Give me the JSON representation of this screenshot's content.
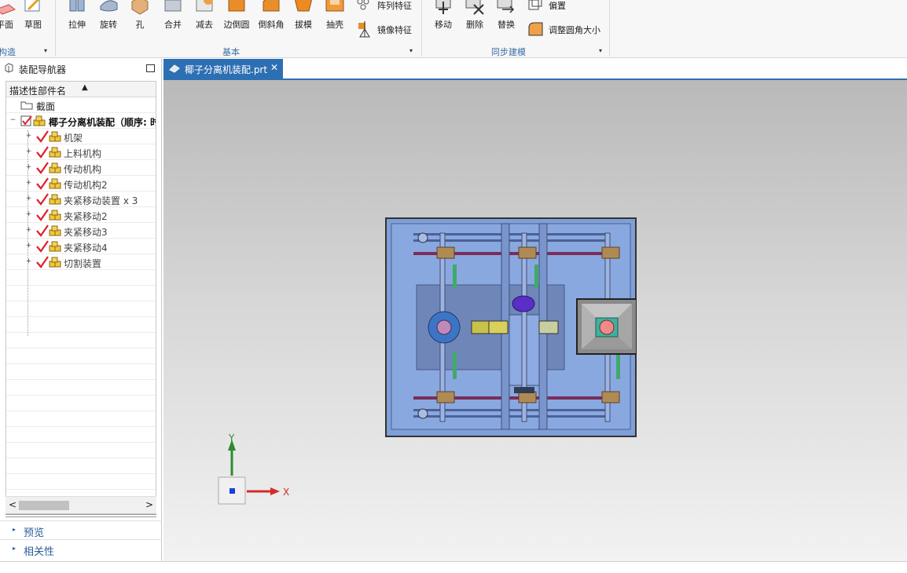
{
  "ribbon": {
    "left_buttons": [
      {
        "label": "平面",
        "icon": "datum-plane-icon"
      },
      {
        "label": "草图",
        "icon": "sketch-pencil-icon"
      }
    ],
    "left_group_label": "构造",
    "basic_buttons": [
      {
        "label": "拉伸",
        "icon": "extrude-icon"
      },
      {
        "label": "旋转",
        "icon": "revolve-icon"
      },
      {
        "label": "孔",
        "icon": "hole-icon"
      },
      {
        "label": "合并",
        "icon": "unite-icon"
      },
      {
        "label": "减去",
        "icon": "subtract-icon"
      },
      {
        "label": "边倒圆",
        "icon": "edge-blend-icon"
      },
      {
        "label": "倒斜角",
        "icon": "chamfer-icon"
      },
      {
        "label": "拔模",
        "icon": "draft-icon"
      },
      {
        "label": "抽壳",
        "icon": "shell-icon"
      }
    ],
    "basic_small": [
      {
        "label": "阵列特征",
        "icon": "pattern-feature-icon"
      },
      {
        "label": "镜像特征",
        "icon": "mirror-feature-icon"
      }
    ],
    "basic_group_label": "基本",
    "sync_buttons": [
      {
        "label": "移动",
        "icon": "move-face-icon"
      },
      {
        "label": "删除",
        "icon": "delete-face-icon"
      },
      {
        "label": "替换",
        "icon": "replace-face-icon"
      }
    ],
    "sync_small": [
      {
        "label": "偏置",
        "icon": "offset-face-icon"
      },
      {
        "label": "调整圆角大小",
        "icon": "resize-blend-icon"
      }
    ],
    "sync_group_label": "同步建模",
    "dropdown_glyph": "▾"
  },
  "navigator": {
    "title": "装配导航器",
    "column_header": "描述性部件名",
    "sort_glyph": "▲",
    "section_folder": "截面",
    "root_label": "椰子分离机装配（顺序: 时",
    "items": [
      {
        "label": "机架"
      },
      {
        "label": "上料机构"
      },
      {
        "label": "传动机构"
      },
      {
        "label": "传动机构2"
      },
      {
        "label": "夹紧移动装置 x 3"
      },
      {
        "label": "夹紧移动2"
      },
      {
        "label": "夹紧移动3"
      },
      {
        "label": "夹紧移动4"
      },
      {
        "label": "切割装置"
      }
    ],
    "expand_glyph": "+",
    "collapse_glyph": "−",
    "scroll_left": "<",
    "scroll_right": ">",
    "panels": [
      {
        "label": "预览"
      },
      {
        "label": "相关性"
      }
    ],
    "panel_arrow": "▸"
  },
  "document": {
    "tab_label": "椰子分离机装配.prt",
    "close_glyph": "✕"
  },
  "viewport": {
    "axis_x": "X",
    "axis_y": "Y"
  },
  "colors": {
    "accent": "#2d6fb3",
    "model_blue": "#7f9fd9",
    "check_red": "#e0202a",
    "x_axis": "#d42a2a",
    "y_axis": "#2e8b2e"
  }
}
